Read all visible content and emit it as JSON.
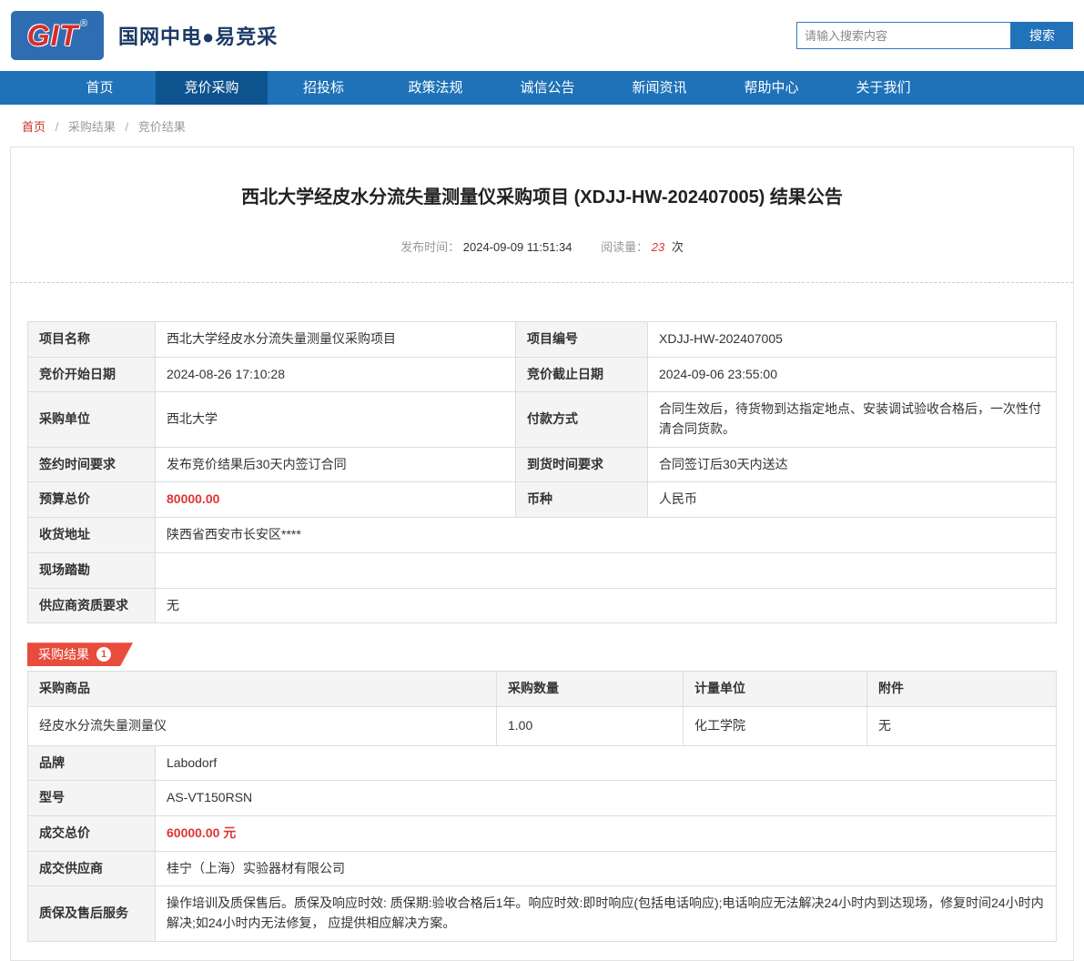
{
  "header": {
    "logo_text": "GIT",
    "logo_reg": "®",
    "site_title": "国网中电●易竞采",
    "search": {
      "placeholder": "请输入搜索内容",
      "button_label": "搜索"
    }
  },
  "nav": {
    "items": [
      {
        "label": "首页"
      },
      {
        "label": "竞价采购"
      },
      {
        "label": "招投标"
      },
      {
        "label": "政策法规"
      },
      {
        "label": "诚信公告"
      },
      {
        "label": "新闻资讯"
      },
      {
        "label": "帮助中心"
      },
      {
        "label": "关于我们"
      }
    ],
    "active_label": "竞价采购"
  },
  "breadcrumb": {
    "separator": "/",
    "items": [
      {
        "label": "首页"
      },
      {
        "label": "采购结果"
      },
      {
        "label": "竞价结果"
      }
    ]
  },
  "article": {
    "title": "西北大学经皮水分流失量测量仪采购项目 (XDJJ-HW-202407005) 结果公告",
    "publish_label": "发布时间：",
    "publish_time": "2024-09-09 11:51:34",
    "views_label": "阅读量：",
    "views_count": "23",
    "views_unit": "次"
  },
  "info": {
    "project_name_label": "项目名称",
    "project_name": "西北大学经皮水分流失量测量仪采购项目",
    "project_no_label": "项目编号",
    "project_no": "XDJJ-HW-202407005",
    "start_label": "竞价开始日期",
    "start_time": "2024-08-26 17:10:28",
    "end_label": "竞价截止日期",
    "end_time": "2024-09-06 23:55:00",
    "buyer_label": "采购单位",
    "buyer": "西北大学",
    "payment_label": "付款方式",
    "payment": "合同生效后，待货物到达指定地点、安装调试验收合格后，一次性付清合同货款。",
    "sign_label": "签约时间要求",
    "sign": "发布竞价结果后30天内签订合同",
    "delivery_label": "到货时间要求",
    "delivery": "合同签订后30天内送达",
    "budget_label": "预算总价",
    "budget": "80000.00",
    "currency_label": "币种",
    "currency": "人民币",
    "address_label": "收货地址",
    "address": "陕西省西安市长安区****",
    "survey_label": "现场踏勘",
    "survey": "",
    "qualification_label": "供应商资质要求",
    "qualification": "无"
  },
  "result": {
    "badge_label": "采购结果",
    "badge_count": "1",
    "columns": [
      "采购商品",
      "采购数量",
      "计量单位",
      "附件"
    ],
    "product": {
      "name": "经皮水分流失量测量仪",
      "quantity": "1.00",
      "unit": "化工学院",
      "attachment": "无"
    },
    "brand_label": "品牌",
    "brand": "Labodorf",
    "model_label": "型号",
    "model": "AS-VT150RSN",
    "total_label": "成交总价",
    "total": "60000.00 元",
    "supplier_label": "成交供应商",
    "supplier": "桂宁（上海）实验器材有限公司",
    "service_label": "质保及售后服务",
    "service": "操作培训及质保售后。质保及响应时效: 质保期:验收合格后1年。响应时效:即时响应(包括电话响应);电话响应无法解决24小时内到达现场，修复时间24小时内解决;如24小时内无法修复， 应提供相应解决方案。"
  },
  "colors": {
    "nav_blue": "#1f72b8",
    "nav_active_blue": "#0d538e",
    "accent_red": "#e03434",
    "badge_red": "#e74c3c"
  }
}
